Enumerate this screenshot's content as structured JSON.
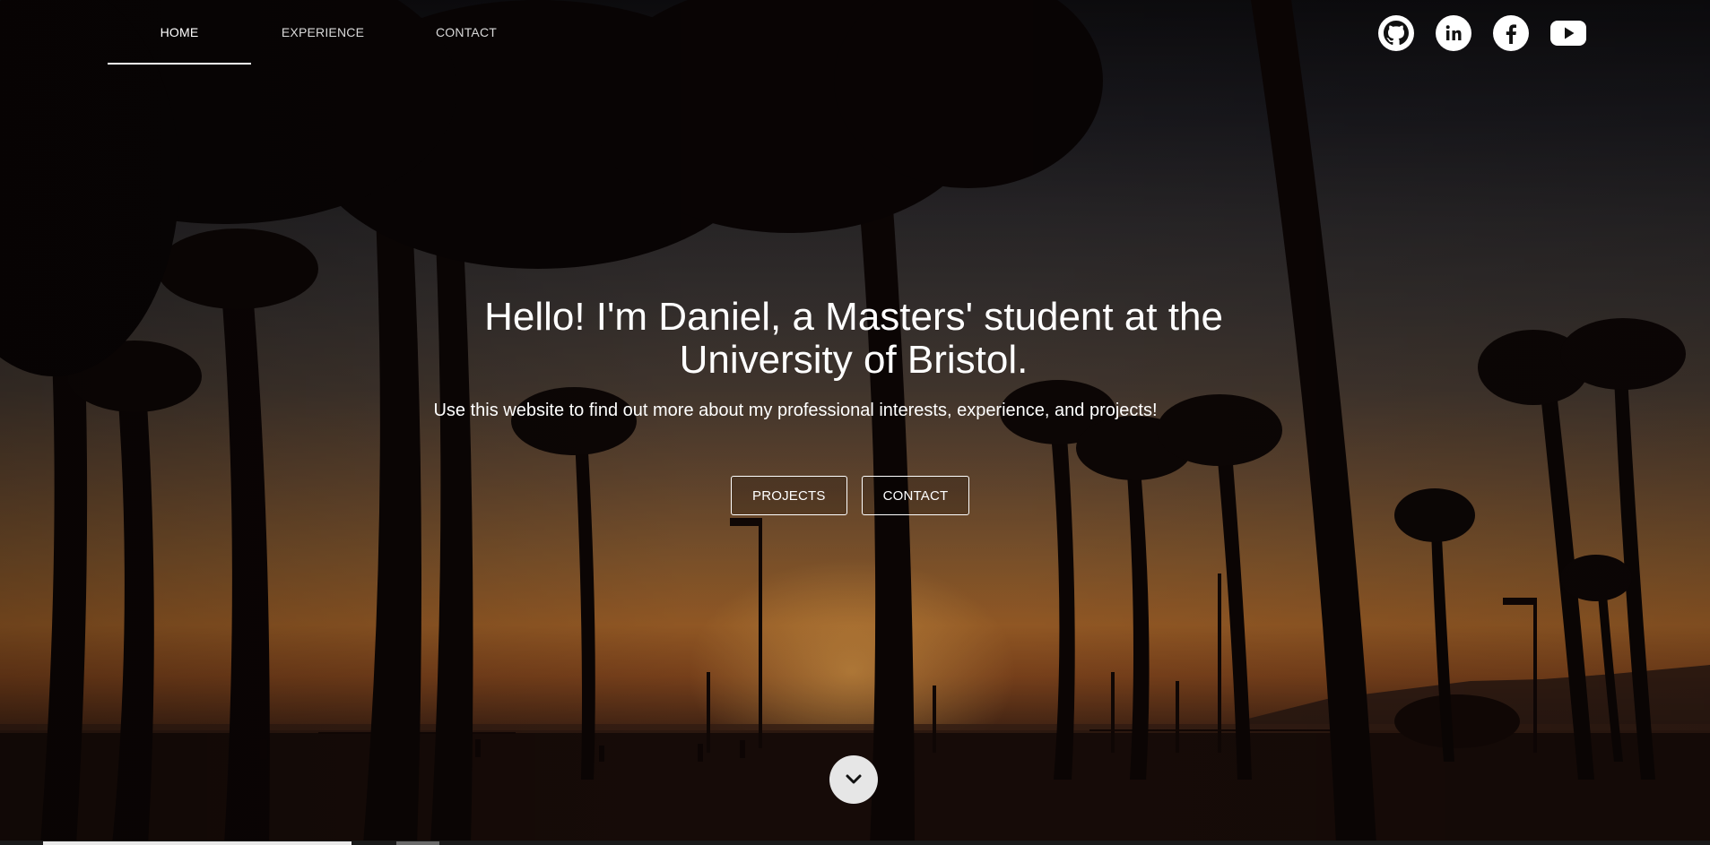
{
  "nav": {
    "items": [
      {
        "label": "HOME",
        "active": true
      },
      {
        "label": "EXPERIENCE",
        "active": false
      },
      {
        "label": "CONTACT",
        "active": false
      }
    ]
  },
  "social": {
    "icons": [
      "github-icon",
      "linkedin-icon",
      "facebook-icon",
      "youtube-icon"
    ]
  },
  "hero": {
    "headline": "Hello! I'm Daniel, a Masters' student at the University of Bristol.",
    "subline": "Use this website to find out more about my professional interests, experience, and projects!",
    "buttons": {
      "projects": "PROJECTS",
      "contact": "CONTACT"
    }
  },
  "colors": {
    "text": "#ffffff",
    "scroll_button": "#e6e6e6"
  }
}
